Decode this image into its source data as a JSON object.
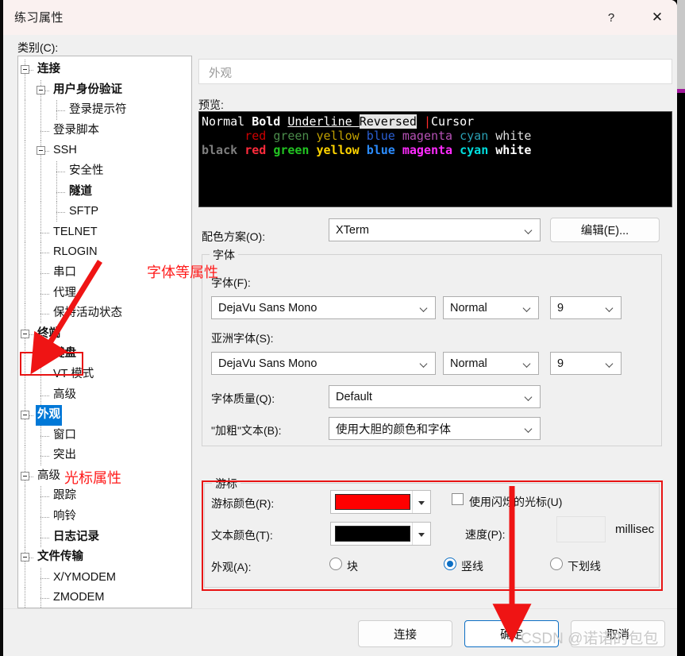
{
  "window": {
    "title": "练习属性",
    "help_label": "?",
    "close_label": "✕"
  },
  "left": {
    "category_label": "类别(C):",
    "tree": [
      {
        "label": "连接",
        "depth": 0,
        "expander": true,
        "bold": true
      },
      {
        "label": "用户身份验证",
        "depth": 1,
        "expander": true,
        "bold": true
      },
      {
        "label": "登录提示符",
        "depth": 2,
        "expander": false,
        "bold": false
      },
      {
        "label": "登录脚本",
        "depth": 1,
        "expander": false,
        "bold": false
      },
      {
        "label": "SSH",
        "depth": 1,
        "expander": true,
        "bold": false
      },
      {
        "label": "安全性",
        "depth": 2,
        "expander": false,
        "bold": false
      },
      {
        "label": "隧道",
        "depth": 2,
        "expander": false,
        "bold": true
      },
      {
        "label": "SFTP",
        "depth": 2,
        "expander": false,
        "bold": false
      },
      {
        "label": "TELNET",
        "depth": 1,
        "expander": false,
        "bold": false
      },
      {
        "label": "RLOGIN",
        "depth": 1,
        "expander": false,
        "bold": false
      },
      {
        "label": "串口",
        "depth": 1,
        "expander": false,
        "bold": false
      },
      {
        "label": "代理",
        "depth": 1,
        "expander": false,
        "bold": false
      },
      {
        "label": "保持活动状态",
        "depth": 1,
        "expander": false,
        "bold": false
      },
      {
        "label": "终端",
        "depth": 0,
        "expander": true,
        "bold": true
      },
      {
        "label": "键盘",
        "depth": 1,
        "expander": false,
        "bold": true
      },
      {
        "label": "VT 模式",
        "depth": 1,
        "expander": false,
        "bold": false
      },
      {
        "label": "高级",
        "depth": 1,
        "expander": false,
        "bold": false
      },
      {
        "label": "外观",
        "depth": 0,
        "expander": true,
        "bold": true,
        "selected": true
      },
      {
        "label": "窗口",
        "depth": 1,
        "expander": false,
        "bold": false
      },
      {
        "label": "突出",
        "depth": 1,
        "expander": false,
        "bold": false
      },
      {
        "label": "高级",
        "depth": 0,
        "expander": true,
        "bold": false
      },
      {
        "label": "跟踪",
        "depth": 1,
        "expander": false,
        "bold": false
      },
      {
        "label": "响铃",
        "depth": 1,
        "expander": false,
        "bold": false
      },
      {
        "label": "日志记录",
        "depth": 1,
        "expander": false,
        "bold": true
      },
      {
        "label": "文件传输",
        "depth": 0,
        "expander": true,
        "bold": true
      },
      {
        "label": "X/YMODEM",
        "depth": 1,
        "expander": false,
        "bold": false
      },
      {
        "label": "ZMODEM",
        "depth": 1,
        "expander": false,
        "bold": false
      }
    ]
  },
  "main": {
    "page_header": "外观",
    "preview_label": "预览:",
    "preview": {
      "line1": [
        {
          "text": "Normal ",
          "style": "normal",
          "color": "#ffffff"
        },
        {
          "text": "Bold ",
          "style": "bold",
          "color": "#ffffff"
        },
        {
          "text": "Underline ",
          "style": "underline",
          "color": "#ffffff"
        },
        {
          "text": "Reversed",
          "style": "reversed",
          "color": "#000000"
        },
        {
          "text": " ",
          "style": "normal",
          "color": "#ffffff"
        },
        {
          "text": "|",
          "style": "cursor",
          "color": "#ff2b2b"
        },
        {
          "text": "Cursor",
          "style": "normal",
          "color": "#ffffff"
        }
      ],
      "line2": [
        {
          "text": "      ",
          "color": "#000000"
        },
        {
          "text": "red ",
          "color": "#cd0000"
        },
        {
          "text": "green ",
          "color": "#4b8c4b"
        },
        {
          "text": "yellow ",
          "color": "#c0a000"
        },
        {
          "text": "blue ",
          "color": "#2a5fd4"
        },
        {
          "text": "magenta ",
          "color": "#b451b4"
        },
        {
          "text": "cyan ",
          "color": "#2aa0b4"
        },
        {
          "text": "white",
          "color": "#e0e0e0"
        }
      ],
      "line3": [
        {
          "text": "black ",
          "color": "#7f7f7f"
        },
        {
          "text": "red ",
          "color": "#ff2b3c"
        },
        {
          "text": "green ",
          "color": "#22c322"
        },
        {
          "text": "yellow ",
          "color": "#ffd400"
        },
        {
          "text": "blue ",
          "color": "#2b8cff"
        },
        {
          "text": "magenta ",
          "color": "#ff2bff"
        },
        {
          "text": "cyan ",
          "color": "#00dede"
        },
        {
          "text": "white",
          "color": "#ffffff"
        }
      ]
    },
    "scheme": {
      "label": "配色方案(O):",
      "value": "XTerm",
      "edit_button": "编辑(E)..."
    },
    "font_group": {
      "title": "字体",
      "font_label": "字体(F):",
      "font_value": "DejaVu Sans Mono",
      "font_style_value": "Normal",
      "font_size_value": "9",
      "asian_label": "亚洲字体(S):",
      "asian_value": "DejaVu Sans Mono",
      "asian_style_value": "Normal",
      "asian_size_value": "9",
      "quality_label": "字体质量(Q):",
      "quality_value": "Default",
      "bold_label": "\"加粗\"文本(B):",
      "bold_value": "使用大胆的颜色和字体"
    },
    "cursor_group": {
      "title": "游标",
      "cursor_color_label": "游标颜色(R):",
      "cursor_color_value": "#FF0000",
      "text_color_label": "文本颜色(T):",
      "text_color_value": "#000000",
      "appearance_label": "外观(A):",
      "blink_label": "使用闪烁的光标(U)",
      "blink_checked": false,
      "speed_label": "速度(P):",
      "speed_value": "",
      "speed_unit": "millisec",
      "radios": [
        {
          "label": "块",
          "selected": false
        },
        {
          "label": "竖线",
          "selected": true
        },
        {
          "label": "下划线",
          "selected": false
        }
      ]
    }
  },
  "footer": {
    "connect_label": "连接",
    "ok_label": "确定",
    "cancel_label": "取消",
    "watermark": "CSDN @诺诺的包包"
  },
  "annotations": {
    "font_note": "字体等属性",
    "cursor_note": "光标属性",
    "accent_red": "#FF1A1A",
    "highlight_blue": "#0078D7"
  }
}
